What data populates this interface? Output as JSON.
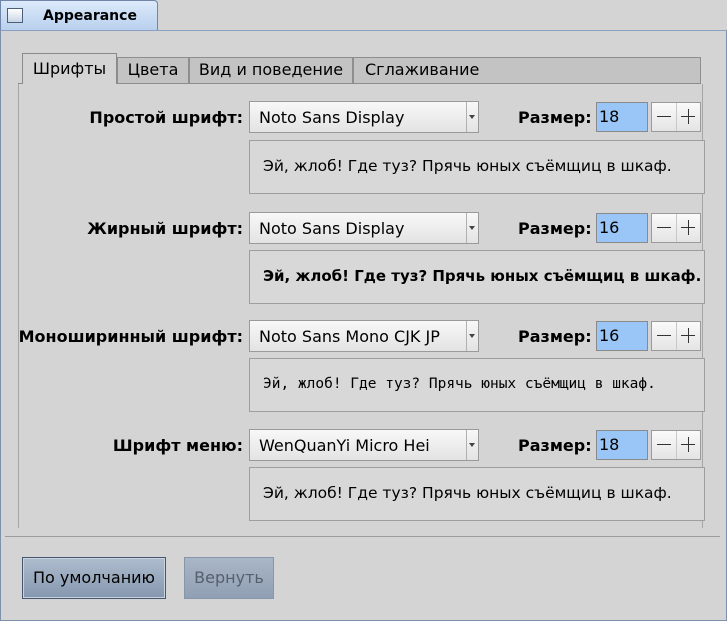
{
  "window": {
    "title": "Appearance"
  },
  "tabs": [
    {
      "label": "Шрифты",
      "active": true
    },
    {
      "label": "Цвета",
      "active": false
    },
    {
      "label": "Вид и поведение",
      "active": false
    },
    {
      "label": "Сглаживание",
      "active": false
    }
  ],
  "fonts": [
    {
      "label": "Простой шрифт:",
      "family": "Noto Sans Display",
      "size_label": "Размер:",
      "size": "18",
      "preview": "Эй, жлоб! Где туз? Прячь юных съёмщиц в шкаф."
    },
    {
      "label": "Жирный шрифт:",
      "family": "Noto Sans Display",
      "size_label": "Размер:",
      "size": "16",
      "preview": "Эй, жлоб! Где туз? Прячь юных съёмщиц в шкаф."
    },
    {
      "label": "Моноширинный шрифт:",
      "family": "Noto Sans Mono CJK JP",
      "size_label": "Размер:",
      "size": "16",
      "preview": "Эй, жлоб! Где туз? Прячь юных съёмщиц в шкаф."
    },
    {
      "label": "Шрифт меню:",
      "family": "WenQuanYi Micro Hei",
      "size_label": "Размер:",
      "size": "18",
      "preview": "Эй, жлоб! Где туз? Прячь юных съёмщиц в шкаф."
    }
  ],
  "buttons": {
    "defaults": "По умолчанию",
    "revert": "Вернуть"
  },
  "colors": {
    "accent": "#9ac6f7",
    "background": "#d4d4d4"
  }
}
